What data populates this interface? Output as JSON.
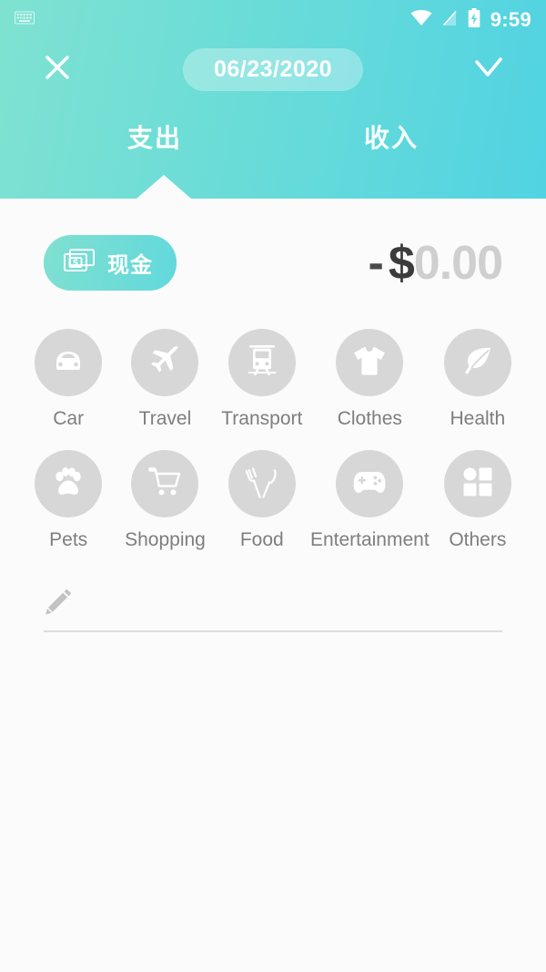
{
  "statusbar": {
    "keyboard_icon": "keyboard-icon",
    "wifi_icon": "wifi-icon",
    "signal_off_icon": "signal-off-icon",
    "battery_charging_icon": "battery-charging-icon",
    "time": "9:59"
  },
  "header": {
    "close_icon": "close-icon",
    "confirm_icon": "check-icon",
    "date": "06/23/2020",
    "gradient_start": "#7FE2D1",
    "gradient_end": "#51D3E2",
    "tabs": [
      {
        "label": "支出",
        "active": true
      },
      {
        "label": "收入",
        "active": false
      }
    ]
  },
  "entry": {
    "account": {
      "label": "现金",
      "icon": "banknote-icon"
    },
    "amount": {
      "sign": "-",
      "currency": "$",
      "value": "0.00"
    }
  },
  "categories": [
    {
      "label": "Car",
      "icon": "car-icon"
    },
    {
      "label": "Travel",
      "icon": "airplane-icon"
    },
    {
      "label": "Transport",
      "icon": "train-icon"
    },
    {
      "label": "Clothes",
      "icon": "tshirt-icon"
    },
    {
      "label": "Health",
      "icon": "leaf-icon"
    },
    {
      "label": "Pets",
      "icon": "paw-icon"
    },
    {
      "label": "Shopping",
      "icon": "shopping-cart-icon"
    },
    {
      "label": "Food",
      "icon": "fork-knife-icon"
    },
    {
      "label": "Entertainment",
      "icon": "gamepad-icon"
    },
    {
      "label": "Others",
      "icon": "grid-icon"
    }
  ],
  "note": {
    "icon": "pencil-icon",
    "value": "",
    "placeholder": ""
  },
  "colors": {
    "circle_gray": "#D7D7D7",
    "label_gray": "#7E7E7E",
    "page_bg": "#FBFBFB"
  }
}
